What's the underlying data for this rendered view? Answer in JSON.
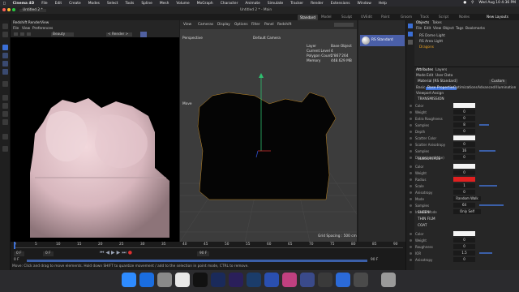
{
  "menubar": {
    "app_name": "Cinema 4D",
    "items": [
      "File",
      "Edit",
      "Create",
      "Modes",
      "Select",
      "Tools",
      "Spline",
      "Mesh",
      "Volume",
      "MoGraph",
      "Character",
      "Animate",
      "Simulate",
      "Tracker",
      "Render",
      "Extensions",
      "Window",
      "Help"
    ],
    "clock": "Wed Aug 10  4:36 PM"
  },
  "window": {
    "doc_tab": "Untitled 2 *",
    "title": "Untitled 2 * - Main",
    "new_layouts": "New Layouts",
    "layout_tabs": [
      "Standard",
      "Model",
      "Sculpt",
      "UVEdit",
      "Paint",
      "Groom",
      "Track",
      "Script",
      "Nodes"
    ]
  },
  "render_view": {
    "title": "Redshift RenderView",
    "menus": [
      "File",
      "View",
      "Preferences"
    ],
    "mode": "Beauty",
    "render_field": "< Render >"
  },
  "viewport": {
    "menus": [
      "View",
      "Cameras",
      "Display",
      "Options",
      "Filter",
      "Panel",
      "Redshift"
    ],
    "projection": "Perspective",
    "camera": "Default Camera",
    "move_label": "Move",
    "grid_spacing": "Grid Spacing : 500 cm",
    "stats": [
      {
        "label": "Layer",
        "value": "Base Object"
      },
      {
        "label": "Current Level",
        "value": "4"
      },
      {
        "label": "Polygon Count",
        "value": "2'867'264"
      },
      {
        "label": "Memory",
        "value": "448.629 MB"
      }
    ]
  },
  "material_strip": {
    "material_name": "RS Standard"
  },
  "objects": {
    "tabs": [
      "Objects",
      "Takes"
    ],
    "menus": [
      "File",
      "Edit",
      "View",
      "Object",
      "Tags",
      "Bookmarks"
    ],
    "items": [
      "RS Dome Light",
      "RS Area Light",
      "Dragons"
    ]
  },
  "attributes": {
    "tabs": [
      "Attributes",
      "Layers"
    ],
    "menus": [
      "Mode",
      "Edit",
      "User Data"
    ],
    "material": "Material [RS Standard]",
    "preset": "Custom",
    "subtabs": [
      "Basic",
      "Base Properties",
      "Optimizations",
      "Advanced",
      "Illumination"
    ],
    "subtabs2": [
      "Viewport",
      "Assign"
    ],
    "sections": {
      "transmission": "TRANSMISSION",
      "subsurface": "SUBSURFACE",
      "sheen": "SHEEN",
      "thin_film": "THIN FILM",
      "coat": "COAT"
    },
    "transmission_rows": [
      {
        "label": "Color",
        "value": ""
      },
      {
        "label": "Weight",
        "value": "0"
      },
      {
        "label": "Extra Roughness",
        "value": "0"
      },
      {
        "label": "Samples",
        "value": "8"
      },
      {
        "label": "Depth",
        "value": "0"
      },
      {
        "label": "Scatter Color",
        "value": ""
      },
      {
        "label": "Scatter Anisotropy",
        "value": "0"
      },
      {
        "label": "Samples",
        "value": "16"
      },
      {
        "label": "Dispersion (Abbe)",
        "value": "0"
      }
    ],
    "subsurface_rows": [
      {
        "label": "Color",
        "value": ""
      },
      {
        "label": "Weight",
        "value": "0"
      },
      {
        "label": "Radius",
        "value": ""
      },
      {
        "label": "Scale",
        "value": "1"
      },
      {
        "label": "Anisotropy",
        "value": "0"
      },
      {
        "label": "Mode",
        "value": "Random Walk"
      },
      {
        "label": "Samples",
        "value": "64"
      },
      {
        "label": "Include Mode",
        "value": "Only Self"
      }
    ],
    "coat_rows": [
      {
        "label": "Color",
        "value": ""
      },
      {
        "label": "Weight",
        "value": "0"
      },
      {
        "label": "Roughness",
        "value": "0"
      },
      {
        "label": "IOR",
        "value": "1.5"
      },
      {
        "label": "Anisotropy",
        "value": "0"
      }
    ]
  },
  "timeline": {
    "ticks": [
      "0",
      "5",
      "10",
      "15",
      "20",
      "25",
      "30",
      "35",
      "40",
      "45",
      "50",
      "55",
      "60",
      "65",
      "70",
      "75",
      "80",
      "85",
      "90"
    ],
    "current_frame": "0 F",
    "start_frame": "0 F",
    "end_frame": "90 F",
    "range_start": "0 F",
    "range_end": "90 F"
  },
  "status_message": "Move: Click and drag to move elements. Hold down SHIFT to quantize movement / add to the selection in point mode, CTRL to remove.",
  "colors": {
    "accent": "#3b6fd6",
    "radius_red": "#e02020",
    "selection_orange": "#e8a020"
  }
}
